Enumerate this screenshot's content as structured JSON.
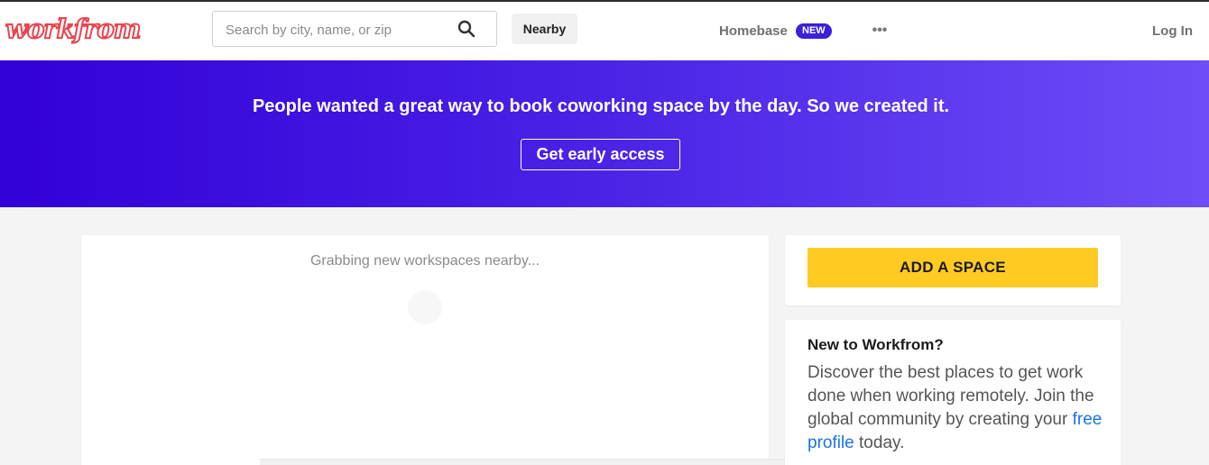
{
  "header": {
    "logo_text": "workfrom",
    "search_placeholder": "Search by city, name, or zip",
    "nearby_label": "Nearby",
    "homebase_label": "Homebase",
    "homebase_badge": "NEW",
    "more_label": "•••",
    "login_label": "Log In"
  },
  "hero": {
    "headline": "People wanted a great way to book coworking space by the day. So we created it.",
    "cta_label": "Get early access",
    "gradient_start": "#3200d8",
    "gradient_end": "#6e4df7"
  },
  "main": {
    "loading_text": "Grabbing new workspaces nearby..."
  },
  "sidebar": {
    "add_space_label": "ADD A SPACE",
    "add_space_color": "#ffcb23",
    "new_title": "New to Workfrom?",
    "new_body_before": "Discover the best places to get work done when working remotely. Join the global community by creating your ",
    "new_body_link": "free profile",
    "new_body_after": " today."
  },
  "icons": {
    "search": "search-icon",
    "more": "more-dots-icon",
    "spinner": "loading-spinner-icon"
  }
}
